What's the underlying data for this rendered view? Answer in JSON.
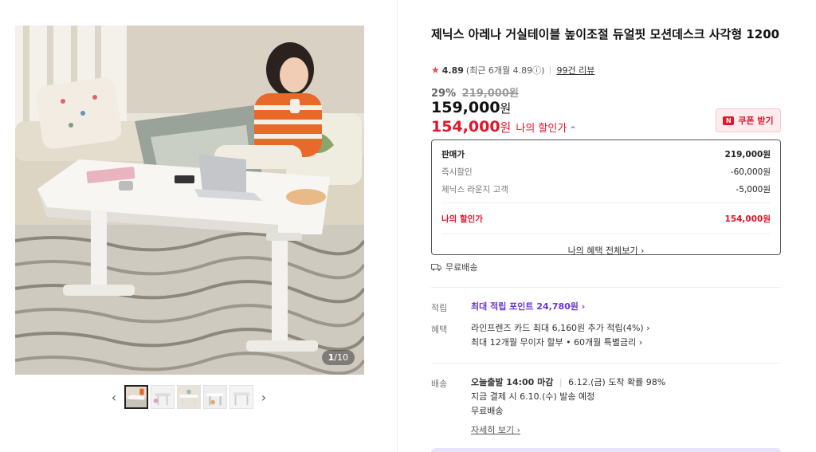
{
  "gallery": {
    "counter_current": "1",
    "counter_total": "/10",
    "prev_arrow": "‹",
    "next_arrow": "›",
    "thumbnail_count": 5
  },
  "product": {
    "title": "제닉스 아레나 거실테이블 높이조절 듀얼핏 모션데스크 사각형 1200",
    "rating": {
      "star": "★",
      "score": "4.89",
      "recent": "(최근 6개월 4.89ⓘ)",
      "reviews": "99건 리뷰"
    },
    "discount_rate": "29%",
    "original_price": "219,000원",
    "price": "159,000",
    "price_unit": "원",
    "my_price": "154,000",
    "my_price_unit": "원",
    "my_price_label": "나의 할인가",
    "my_price_caret": "^",
    "coupon_label": "쿠폰 받기",
    "coupon_logo": "N"
  },
  "price_box": {
    "rows": [
      {
        "label": "판매가",
        "value": "219,000원"
      },
      {
        "label": "즉시할인",
        "value": "-60,000원"
      },
      {
        "label": "제닉스 라운지 고객",
        "value": "-5,000원"
      }
    ],
    "my_label": "나의 할인가",
    "my_value": "154,000원",
    "footer": "나의 혜택 전체보기 ›"
  },
  "shipping_badge": "무료배송",
  "benefits": {
    "points_label": "적립",
    "points_value": "최대 적립 포인트 24,780원 ›",
    "benefit_label": "혜택",
    "benefit_line1": "라인프렌즈 카드 최대 6,160원 추가 적립(4%) ›",
    "benefit_line2": "최대 12개월 무이자 할부 • 60개월 특별금리 ›"
  },
  "delivery": {
    "label": "배송",
    "line1_bold": "오늘출발 14:00 마감",
    "line1_rest": "6.12.(금) 도착 확률 98%",
    "line2": "지금 결제 시 6.10.(수) 발송 예정",
    "line3": "무료배송",
    "details_link": "자세히 보기 ›"
  },
  "colors": {
    "accent_red": "#e3152b",
    "point_purple": "#6a35d9",
    "star": "#f04646"
  }
}
